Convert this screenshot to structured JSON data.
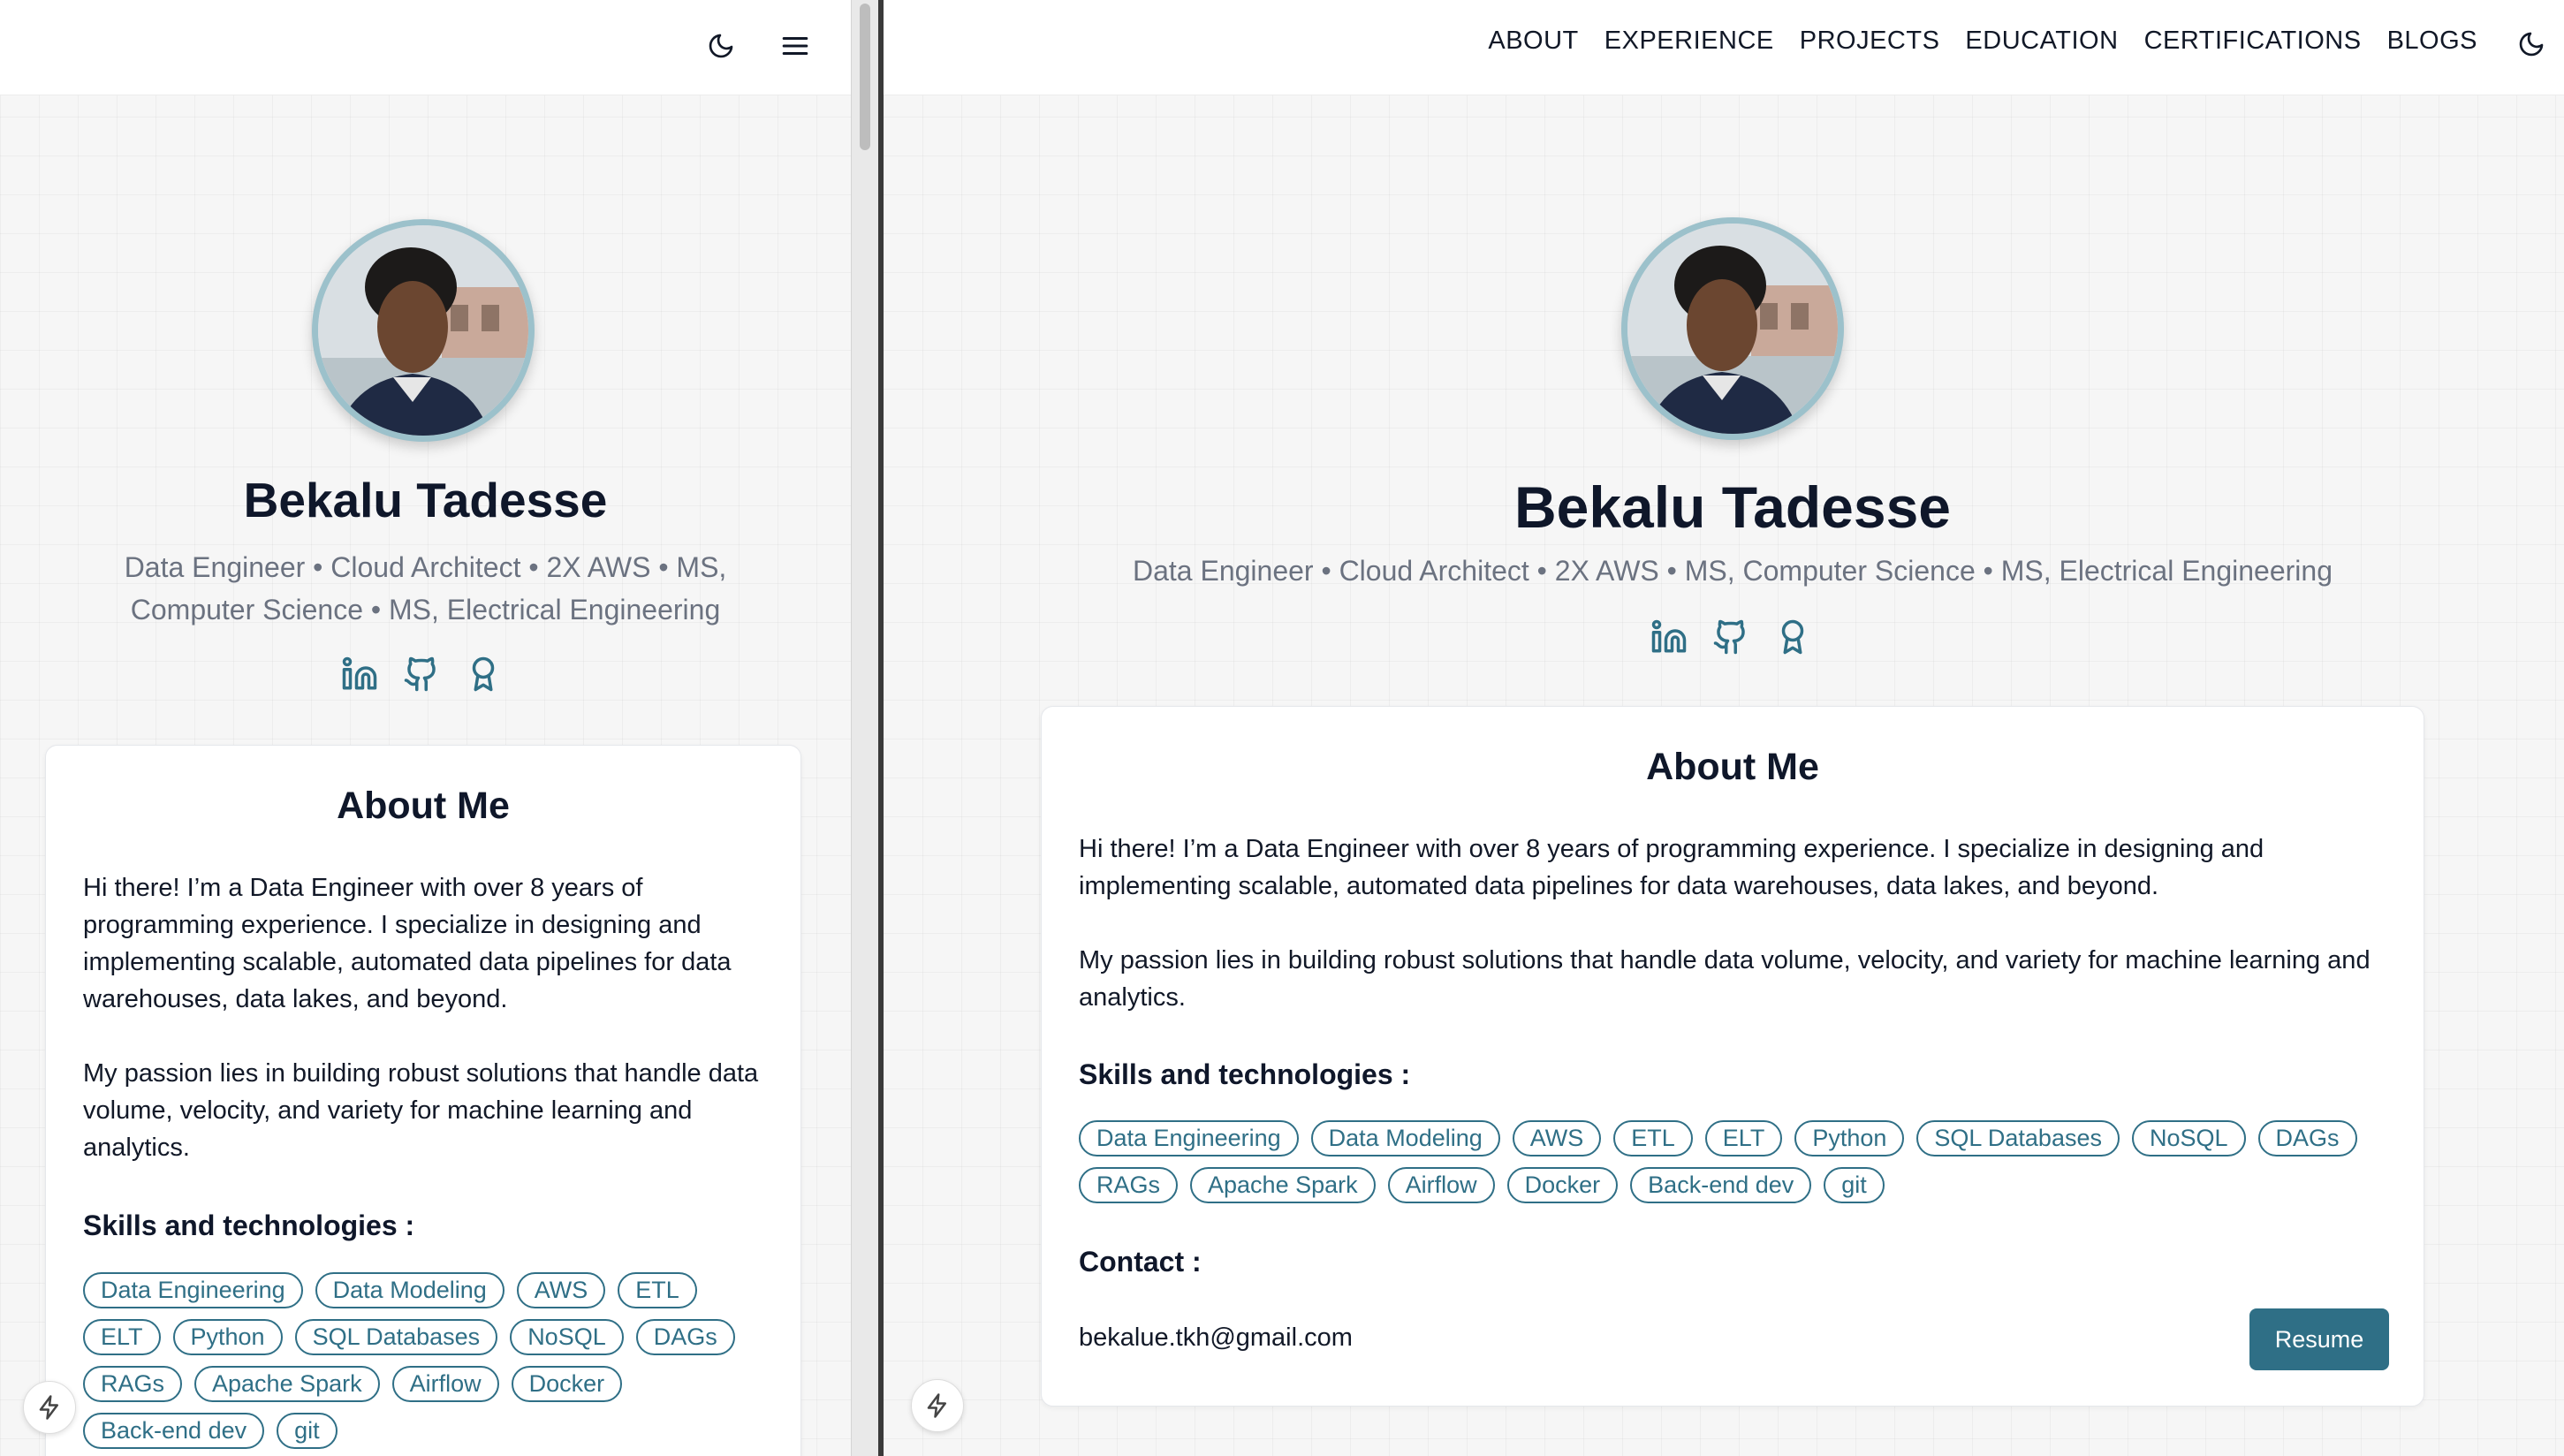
{
  "nav": {
    "links": [
      "ABOUT",
      "EXPERIENCE",
      "PROJECTS",
      "EDUCATION",
      "CERTIFICATIONS",
      "BLOGS"
    ],
    "theme_icon": "moon-icon",
    "menu_icon": "hamburger-menu-icon"
  },
  "profile": {
    "name": "Bekalu Tadesse",
    "subtitle": "Data Engineer • Cloud Architect • 2X AWS • MS, Computer Science • MS, Electrical Engineering",
    "subtitle_line1": "Data Engineer • Cloud Architect • 2X AWS • MS,",
    "subtitle_line2": "Computer Science • MS, Electrical Engineering",
    "socials": [
      "linkedin-icon",
      "github-icon",
      "award-icon"
    ]
  },
  "about": {
    "heading": "About Me",
    "paragraph1": "Hi there! I’m a Data Engineer with over 8 years of programming experience. I specialize in designing and implementing scalable, automated data pipelines for data warehouses, data lakes, and beyond.",
    "paragraph2": "My passion lies in building robust solutions that handle data volume, velocity, and variety for machine learning and analytics.",
    "skills_title": "Skills and technologies :",
    "skills": [
      "Data Engineering",
      "Data Modeling",
      "AWS",
      "ETL",
      "ELT",
      "Python",
      "SQL Databases",
      "NoSQL",
      "DAGs",
      "RAGs",
      "Apache Spark",
      "Airflow",
      "Docker",
      "Back-end dev",
      "git"
    ],
    "contact_title": "Contact :",
    "email": "bekalue.tkh@gmail.com",
    "resume_label": "Resume"
  },
  "colors": {
    "accent": "#2f6f86",
    "text": "#111827",
    "muted": "#6b7280",
    "card": "#ffffff"
  }
}
